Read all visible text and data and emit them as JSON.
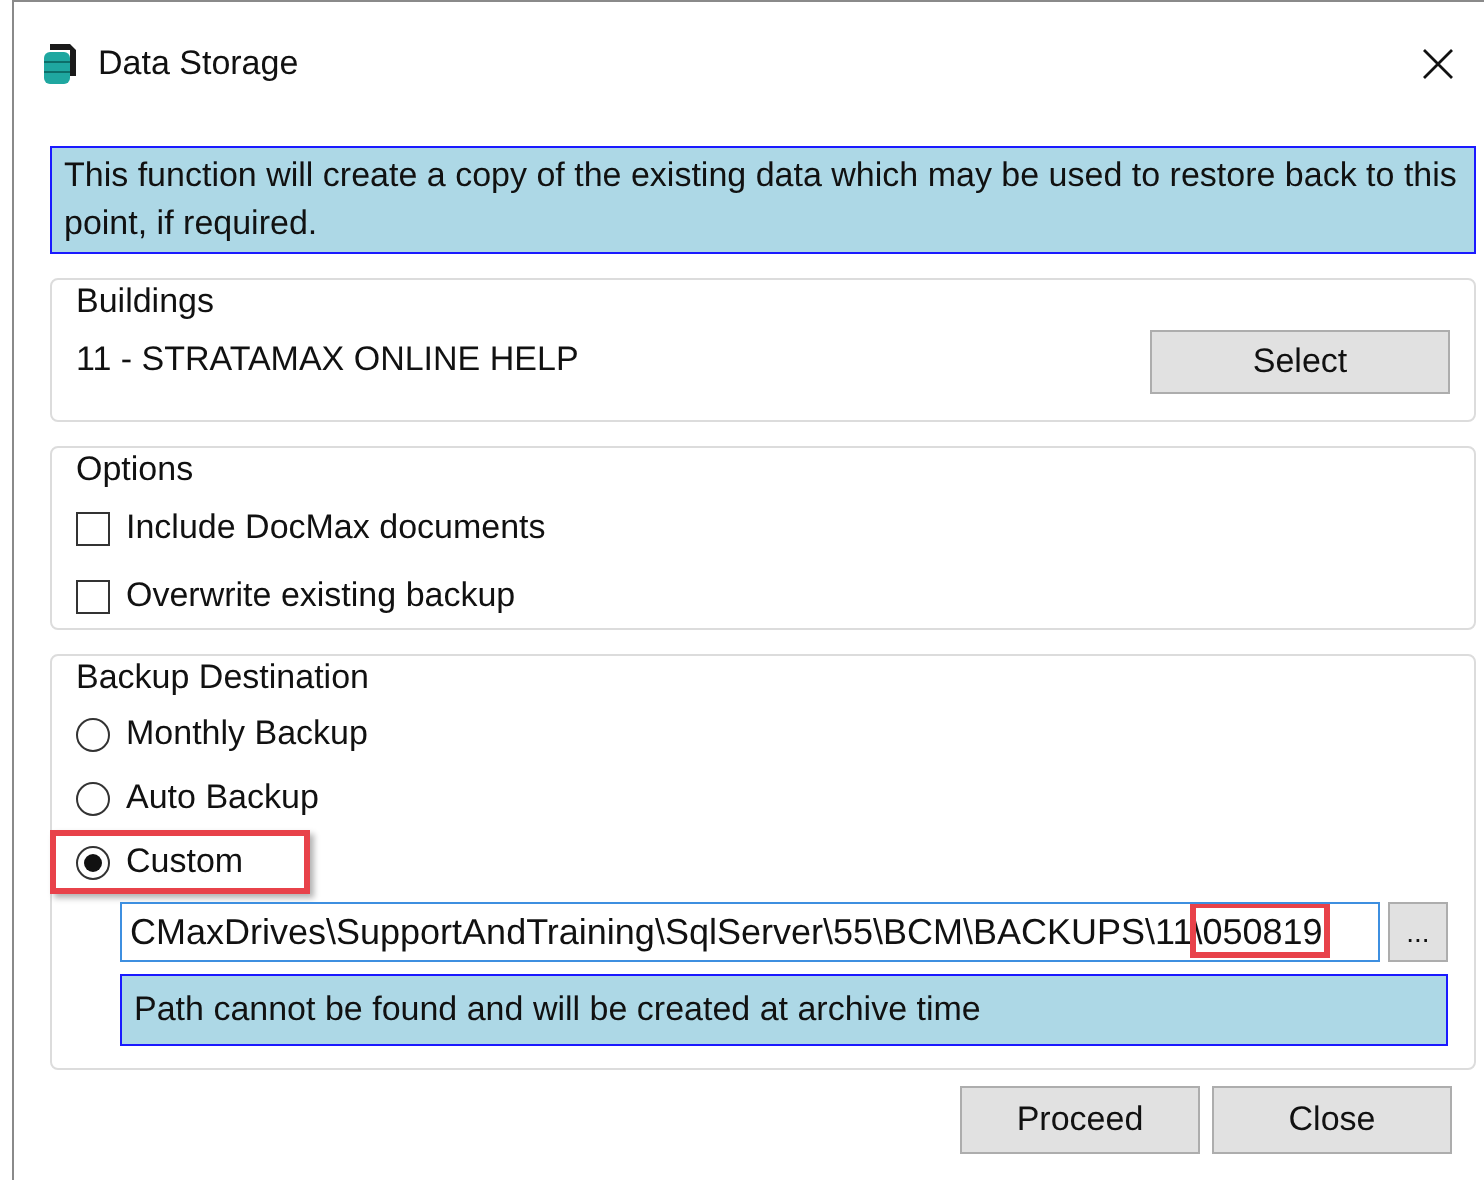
{
  "window": {
    "title": "Data Storage"
  },
  "info": "This function will create a copy of the existing data which may be used to restore back to this point, if required.",
  "buildings": {
    "legend": "Buildings",
    "value": "11 - STRATAMAX ONLINE HELP",
    "button": "Select"
  },
  "options": {
    "legend": "Options",
    "items": [
      {
        "label": "Include DocMax documents",
        "checked": false
      },
      {
        "label": "Overwrite existing backup",
        "checked": false
      }
    ]
  },
  "backup_destination": {
    "legend": "Backup Destination",
    "items": [
      {
        "label": "Monthly Backup",
        "selected": false,
        "highlighted": false
      },
      {
        "label": "Auto Backup",
        "selected": false,
        "highlighted": false
      },
      {
        "label": "Custom",
        "selected": true,
        "highlighted": true
      }
    ],
    "path": {
      "value": "CMaxDrives\\SupportAndTraining\\SqlServer\\55\\BCM\\BACKUPS\\11\\050819",
      "end_highlighted": true
    },
    "browse_button": "...",
    "message": "Path cannot be found and will be created at archive time"
  },
  "buttons": [
    "Proceed",
    "Close"
  ]
}
